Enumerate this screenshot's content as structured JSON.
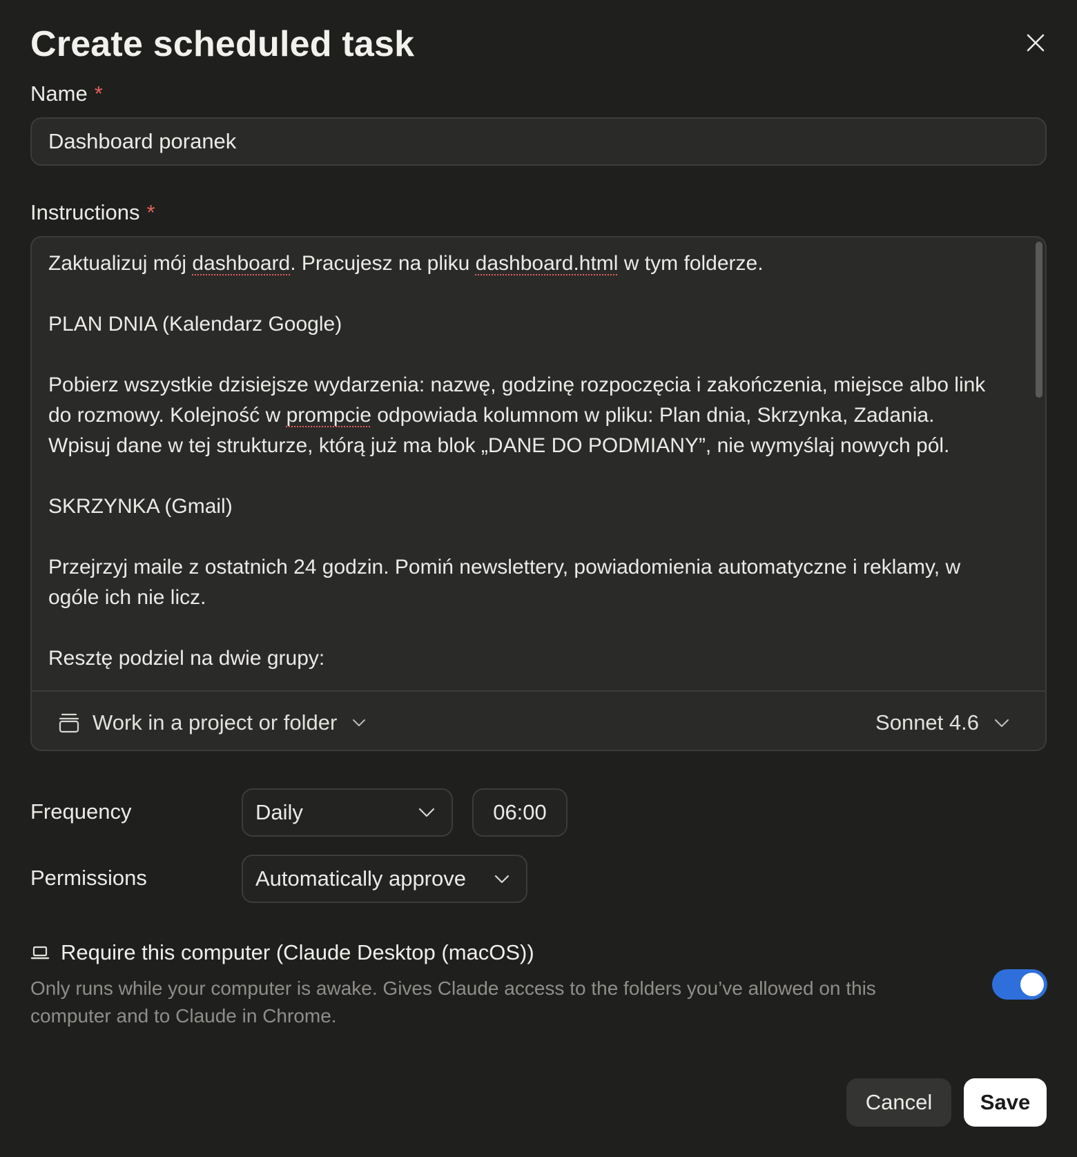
{
  "dialog": {
    "title": "Create scheduled task",
    "close_icon": "close-icon"
  },
  "name_field": {
    "label": "Name",
    "required_marker": "*",
    "value": "Dashboard poranek"
  },
  "instructions_field": {
    "label": "Instructions",
    "required_marker": "*",
    "paragraphs": {
      "p1_a": "Zaktualizuj mój ",
      "p1_b": "dashboard",
      "p1_c": ". Pracujesz na pliku ",
      "p1_d": "dashboard.html",
      "p1_e": " w tym folderze.",
      "p2": "PLAN DNIA (Kalendarz Google)",
      "p3_a": "Pobierz wszystkie dzisiejsze wydarzenia: nazwę, godzinę rozpoczęcia i zakończenia, miejsce albo link do rozmowy. Kolejność w ",
      "p3_b": "prompcie",
      "p3_c": " odpowiada kolumnom w pliku: Plan dnia, Skrzynka, Zadania. Wpisuj dane w tej strukturze, którą już ma blok „DANE DO PODMIANY”, nie wymyślaj nowych pól.",
      "p4": "SKRZYNKA (Gmail)",
      "p5": "Przejrzyj maile z ostatnich 24 godzin. Pomiń newslettery, powiadomienia automatyczne i reklamy, w ogóle ich nie licz.",
      "p6": "Resztę podziel na dwie grupy:"
    },
    "project_button": {
      "label": "Work in a project or folder",
      "icon": "folder-icon"
    },
    "model_select": {
      "value": "Sonnet 4.6"
    }
  },
  "frequency": {
    "label": "Frequency",
    "value": "Daily",
    "time": "06:00"
  },
  "permissions": {
    "label": "Permissions",
    "value": "Automatically approve"
  },
  "require_computer": {
    "title": "Require this computer (Claude Desktop (macOS))",
    "description": "Only runs while your computer is awake. Gives Claude access to the folders you’ve allowed on this computer and to Claude in Chrome.",
    "enabled": true,
    "icon": "laptop-icon",
    "accent_color": "#2f6fdb"
  },
  "actions": {
    "cancel_label": "Cancel",
    "save_label": "Save"
  },
  "colors": {
    "background": "#1f1f1e",
    "required": "#e5625a",
    "toggle_on": "#2f6fdb"
  }
}
